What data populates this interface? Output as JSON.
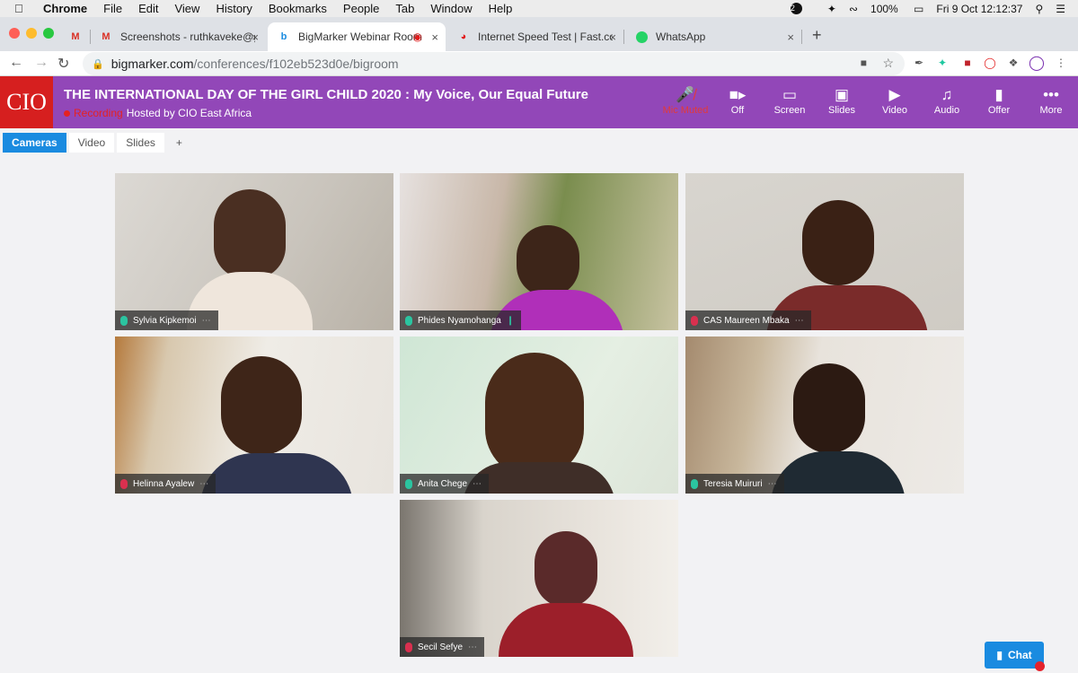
{
  "menubar": {
    "items": [
      "Chrome",
      "File",
      "Edit",
      "View",
      "History",
      "Bookmarks",
      "People",
      "Tab",
      "Window",
      "Help"
    ],
    "notification_count": "2",
    "battery": "100%",
    "datetime": "Fri 9 Oct  12:12:37"
  },
  "tabs": [
    {
      "label": "",
      "favicon": "gmail-icon"
    },
    {
      "label": "Screenshots - ruthkaveke@gm",
      "favicon": "gmail-icon"
    },
    {
      "label": "BigMarker Webinar Room",
      "favicon": "bigmarker-icon"
    },
    {
      "label": "Internet Speed Test | Fast.com",
      "favicon": "fast-icon"
    },
    {
      "label": "WhatsApp",
      "favicon": "whatsapp-icon"
    }
  ],
  "address": {
    "host": "bigmarker.com",
    "path": "/conferences/f102eb523d0e/bigroom"
  },
  "header": {
    "logo": "CIO",
    "title": "THE INTERNATIONAL DAY OF THE GIRL CHILD 2020 : My Voice, Our Equal Future",
    "recording": "Recording",
    "host": "Hosted by CIO East Africa",
    "buttons": [
      {
        "label": "Mic Muted",
        "icon": "mic-muted-icon"
      },
      {
        "label": "Off",
        "icon": "camera-icon"
      },
      {
        "label": "Screen",
        "icon": "screen-icon"
      },
      {
        "label": "Slides",
        "icon": "slides-icon"
      },
      {
        "label": "Video",
        "icon": "video-play-icon"
      },
      {
        "label": "Audio",
        "icon": "music-icon"
      },
      {
        "label": "Offer",
        "icon": "tag-icon"
      },
      {
        "label": "More",
        "icon": "more-icon"
      }
    ]
  },
  "subtabs": [
    "Cameras",
    "Video",
    "Slides",
    "+"
  ],
  "participants": [
    {
      "name": "Sylvia Kipkemoi",
      "mic": "on"
    },
    {
      "name": "Phides Nyamohanga",
      "mic": "on"
    },
    {
      "name": "CAS Maureen Mbaka",
      "mic": "off"
    },
    {
      "name": "Helinna Ayalew",
      "mic": "off"
    },
    {
      "name": "Anita Chege",
      "mic": "on"
    },
    {
      "name": "Teresia Muiruri",
      "mic": "on"
    },
    {
      "name": "Secil Sefye",
      "mic": "off"
    }
  ],
  "chat": {
    "label": "Chat"
  },
  "colors": {
    "header": "#9247b8",
    "accent": "#1a8be0",
    "logo": "#d61f1f",
    "mic_on": "#2bc4a0",
    "mic_off": "#d9304f"
  }
}
